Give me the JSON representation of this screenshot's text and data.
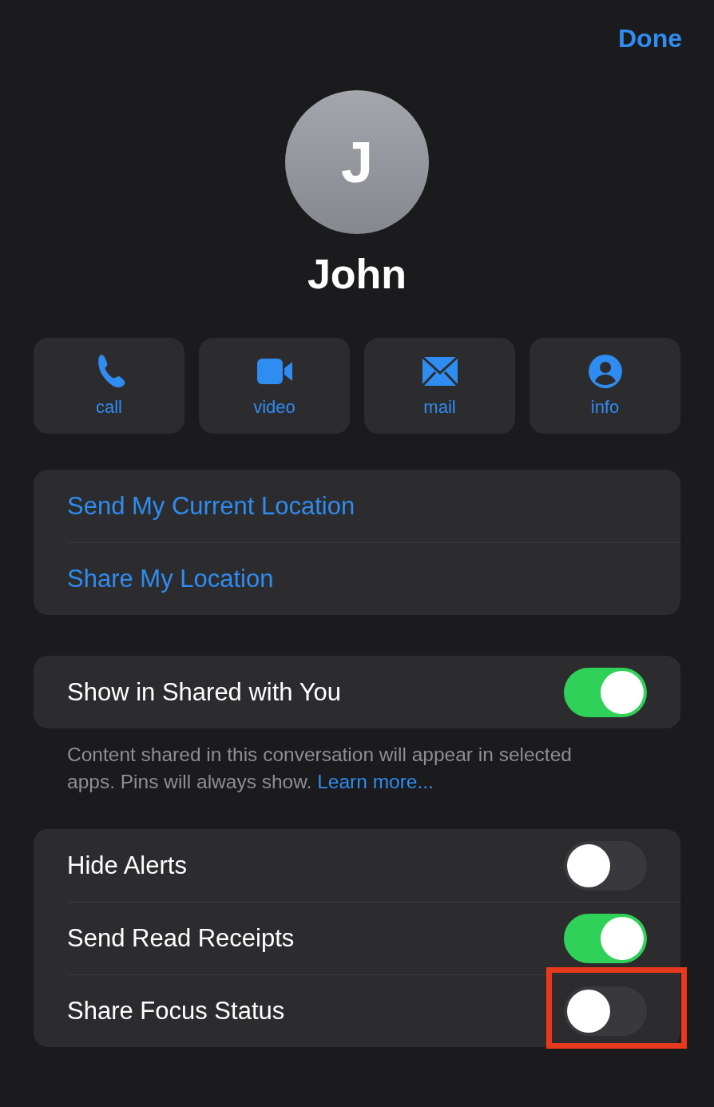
{
  "header": {
    "done_button": "Done"
  },
  "contact": {
    "initial": "J",
    "name": "John"
  },
  "actions": [
    {
      "kind": "call",
      "label": "call"
    },
    {
      "kind": "video",
      "label": "video"
    },
    {
      "kind": "mail",
      "label": "mail"
    },
    {
      "kind": "info",
      "label": "info"
    }
  ],
  "location_links": [
    "Send My Current Location",
    "Share My Location"
  ],
  "shared_with_you": {
    "label": "Show in Shared with You",
    "on": true
  },
  "shared_footer": {
    "text": "Content shared in this conversation will appear in selected apps. Pins will always show.",
    "link": "Learn more..."
  },
  "settings": [
    {
      "label": "Hide Alerts",
      "on": false,
      "highlighted": false
    },
    {
      "label": "Send Read Receipts",
      "on": true,
      "highlighted": false
    },
    {
      "label": "Share Focus Status",
      "on": false,
      "highlighted": true
    }
  ]
}
